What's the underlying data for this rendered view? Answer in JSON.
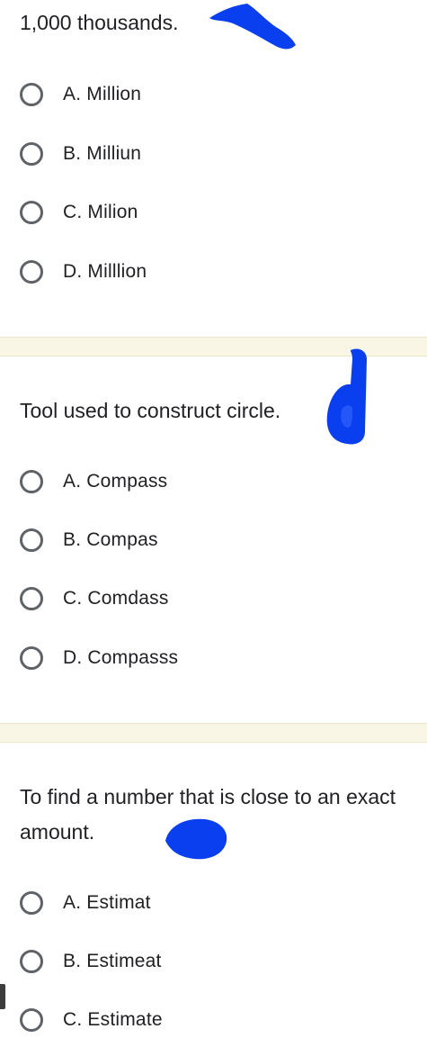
{
  "questions": [
    {
      "text": "1,000 thousands.",
      "options": [
        "A. Million",
        "B. Milliun",
        "C. Milion",
        "D. Milllion"
      ]
    },
    {
      "text": "Tool used to construct circle.",
      "options": [
        "A. Compass",
        "B. Compas",
        "C. Comdass",
        "D. Compasss"
      ]
    },
    {
      "text": "To find a number that is close to an exact amount.",
      "options": [
        "A. Estimat",
        "B. Estimeat",
        "C. Estimate"
      ]
    }
  ],
  "handwritten_answer": "d",
  "colors": {
    "ink": "#0a3ff0",
    "divider": "#faf6e6",
    "radio": "#5f6368",
    "text": "#202124"
  }
}
